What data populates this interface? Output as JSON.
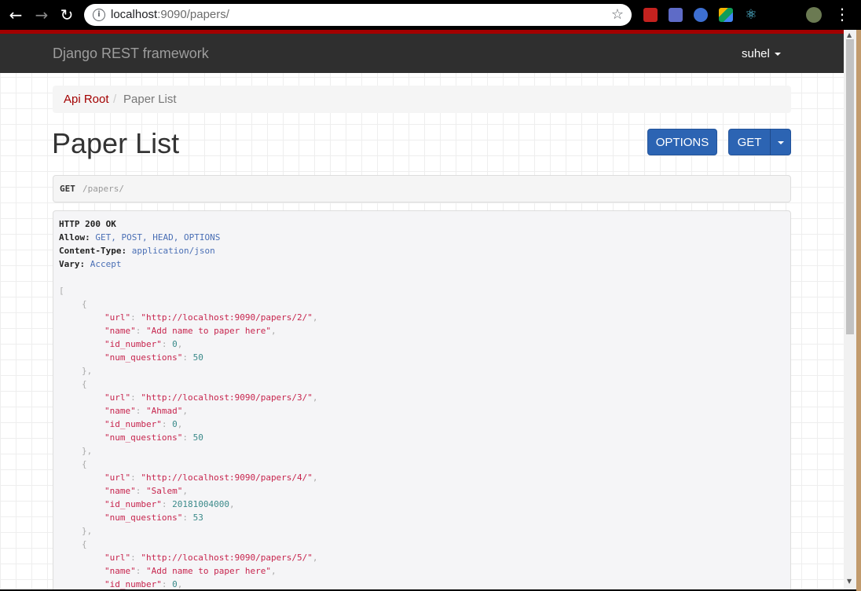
{
  "browser": {
    "url_host": "localhost",
    "url_rest": ":9090/papers/"
  },
  "navbar": {
    "brand": "Django REST framework",
    "user": "suhel"
  },
  "breadcrumb": {
    "root": "Api Root",
    "separator": "/",
    "current": "Paper List"
  },
  "page": {
    "title": "Paper List",
    "options_label": "OPTIONS",
    "get_label": "GET"
  },
  "request": {
    "method": "GET",
    "path": "/papers/"
  },
  "response": {
    "status": "HTTP 200 OK",
    "headers": [
      {
        "key": "Allow",
        "value": "GET, POST, HEAD, OPTIONS"
      },
      {
        "key": "Content-Type",
        "value": "application/json"
      },
      {
        "key": "Vary",
        "value": "Accept"
      }
    ],
    "items": [
      {
        "url": "http://localhost:9090/papers/2/",
        "name": "Add name to paper here",
        "id_number": "0",
        "num_questions": "50"
      },
      {
        "url": "http://localhost:9090/papers/3/",
        "name": "Ahmad",
        "id_number": "0",
        "num_questions": "50"
      },
      {
        "url": "http://localhost:9090/papers/4/",
        "name": "Salem",
        "id_number": "20181004000",
        "num_questions": "53"
      },
      {
        "url": "http://localhost:9090/papers/5/",
        "name": "Add name to paper here",
        "id_number": "0",
        "num_questions": ""
      }
    ]
  },
  "colors": {
    "accent_red": "#a30000",
    "button_blue": "#2c64b3",
    "navbar": "#2f2f2f"
  }
}
